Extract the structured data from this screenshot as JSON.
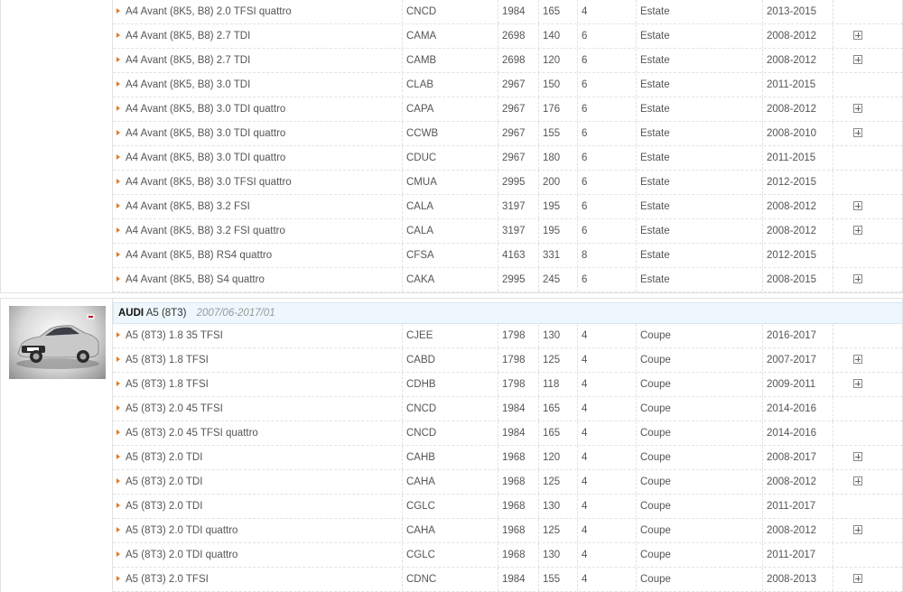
{
  "section1": {
    "rows": [
      {
        "name": "A4 Avant (8K5, B8) 2.0 TFSI quattro",
        "code": "CNCD",
        "cc": "1984",
        "kw": "165",
        "cyl": "4",
        "body": "Estate",
        "years": "2013-2015",
        "plus": false
      },
      {
        "name": "A4 Avant (8K5, B8) 2.7 TDI",
        "code": "CAMA",
        "cc": "2698",
        "kw": "140",
        "cyl": "6",
        "body": "Estate",
        "years": "2008-2012",
        "plus": true
      },
      {
        "name": "A4 Avant (8K5, B8) 2.7 TDI",
        "code": "CAMB",
        "cc": "2698",
        "kw": "120",
        "cyl": "6",
        "body": "Estate",
        "years": "2008-2012",
        "plus": true
      },
      {
        "name": "A4 Avant (8K5, B8) 3.0 TDI",
        "code": "CLAB",
        "cc": "2967",
        "kw": "150",
        "cyl": "6",
        "body": "Estate",
        "years": "2011-2015",
        "plus": false
      },
      {
        "name": "A4 Avant (8K5, B8) 3.0 TDI quattro",
        "code": "CAPA",
        "cc": "2967",
        "kw": "176",
        "cyl": "6",
        "body": "Estate",
        "years": "2008-2012",
        "plus": true
      },
      {
        "name": "A4 Avant (8K5, B8) 3.0 TDI quattro",
        "code": "CCWB",
        "cc": "2967",
        "kw": "155",
        "cyl": "6",
        "body": "Estate",
        "years": "2008-2010",
        "plus": true
      },
      {
        "name": "A4 Avant (8K5, B8) 3.0 TDI quattro",
        "code": "CDUC",
        "cc": "2967",
        "kw": "180",
        "cyl": "6",
        "body": "Estate",
        "years": "2011-2015",
        "plus": false
      },
      {
        "name": "A4 Avant (8K5, B8) 3.0 TFSI quattro",
        "code": "CMUA",
        "cc": "2995",
        "kw": "200",
        "cyl": "6",
        "body": "Estate",
        "years": "2012-2015",
        "plus": false
      },
      {
        "name": "A4 Avant (8K5, B8) 3.2 FSI",
        "code": "CALA",
        "cc": "3197",
        "kw": "195",
        "cyl": "6",
        "body": "Estate",
        "years": "2008-2012",
        "plus": true
      },
      {
        "name": "A4 Avant (8K5, B8) 3.2 FSI quattro",
        "code": "CALA",
        "cc": "3197",
        "kw": "195",
        "cyl": "6",
        "body": "Estate",
        "years": "2008-2012",
        "plus": true
      },
      {
        "name": "A4 Avant (8K5, B8) RS4 quattro",
        "code": "CFSA",
        "cc": "4163",
        "kw": "331",
        "cyl": "8",
        "body": "Estate",
        "years": "2012-2015",
        "plus": false
      },
      {
        "name": "A4 Avant (8K5, B8) S4 quattro",
        "code": "CAKA",
        "cc": "2995",
        "kw": "245",
        "cyl": "6",
        "body": "Estate",
        "years": "2008-2015",
        "plus": true
      }
    ]
  },
  "section2": {
    "brand": "AUDI",
    "model": "A5 (8T3)",
    "period": "2007/06-2017/01",
    "rows": [
      {
        "name": "A5 (8T3) 1.8 35 TFSI",
        "code": "CJEE",
        "cc": "1798",
        "kw": "130",
        "cyl": "4",
        "body": "Coupe",
        "years": "2016-2017",
        "plus": false
      },
      {
        "name": "A5 (8T3) 1.8 TFSI",
        "code": "CABD",
        "cc": "1798",
        "kw": "125",
        "cyl": "4",
        "body": "Coupe",
        "years": "2007-2017",
        "plus": true
      },
      {
        "name": "A5 (8T3) 1.8 TFSI",
        "code": "CDHB",
        "cc": "1798",
        "kw": "118",
        "cyl": "4",
        "body": "Coupe",
        "years": "2009-2011",
        "plus": true
      },
      {
        "name": "A5 (8T3) 2.0 45 TFSI",
        "code": "CNCD",
        "cc": "1984",
        "kw": "165",
        "cyl": "4",
        "body": "Coupe",
        "years": "2014-2016",
        "plus": false
      },
      {
        "name": "A5 (8T3) 2.0 45 TFSI quattro",
        "code": "CNCD",
        "cc": "1984",
        "kw": "165",
        "cyl": "4",
        "body": "Coupe",
        "years": "2014-2016",
        "plus": false
      },
      {
        "name": "A5 (8T3) 2.0 TDI",
        "code": "CAHB",
        "cc": "1968",
        "kw": "120",
        "cyl": "4",
        "body": "Coupe",
        "years": "2008-2017",
        "plus": true
      },
      {
        "name": "A5 (8T3) 2.0 TDI",
        "code": "CAHA",
        "cc": "1968",
        "kw": "125",
        "cyl": "4",
        "body": "Coupe",
        "years": "2008-2012",
        "plus": true
      },
      {
        "name": "A5 (8T3) 2.0 TDI",
        "code": "CGLC",
        "cc": "1968",
        "kw": "130",
        "cyl": "4",
        "body": "Coupe",
        "years": "2011-2017",
        "plus": false
      },
      {
        "name": "A5 (8T3) 2.0 TDI quattro",
        "code": "CAHA",
        "cc": "1968",
        "kw": "125",
        "cyl": "4",
        "body": "Coupe",
        "years": "2008-2012",
        "plus": true
      },
      {
        "name": "A5 (8T3) 2.0 TDI quattro",
        "code": "CGLC",
        "cc": "1968",
        "kw": "130",
        "cyl": "4",
        "body": "Coupe",
        "years": "2011-2017",
        "plus": false
      },
      {
        "name": "A5 (8T3) 2.0 TFSI",
        "code": "CDNC",
        "cc": "1984",
        "kw": "155",
        "cyl": "4",
        "body": "Coupe",
        "years": "2008-2013",
        "plus": true
      }
    ]
  },
  "icons": {
    "row_arrow": "arrow-right-icon",
    "expand": "plus-box-icon"
  },
  "colors": {
    "arrow": "#e57a1f",
    "header_bg": "#eef7fd",
    "border": "#e2e2e2"
  }
}
